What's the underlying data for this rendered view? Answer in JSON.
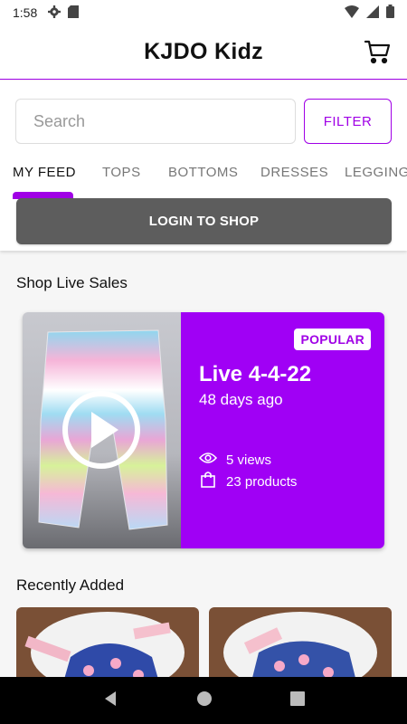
{
  "status_bar": {
    "time": "1:58"
  },
  "header": {
    "title": "KJDO Kidz"
  },
  "search": {
    "placeholder": "Search",
    "filter_label": "FILTER"
  },
  "tabs": [
    {
      "label": "MY FEED",
      "active": true
    },
    {
      "label": "TOPS"
    },
    {
      "label": "BOTTOMS"
    },
    {
      "label": "DRESSES"
    },
    {
      "label": "LEGGING"
    }
  ],
  "login_label": "LOGIN TO SHOP",
  "live_sales": {
    "section_title": "Shop Live Sales",
    "card": {
      "badge": "POPULAR",
      "title": "Live 4-4-22",
      "age": "48 days ago",
      "views": "5 views",
      "products": "23 products"
    }
  },
  "recently_added": {
    "section_title": "Recently Added"
  },
  "colors": {
    "accent": "#a000e6",
    "card_bg": "#a000f5",
    "login_bg": "#5d5d5d"
  }
}
